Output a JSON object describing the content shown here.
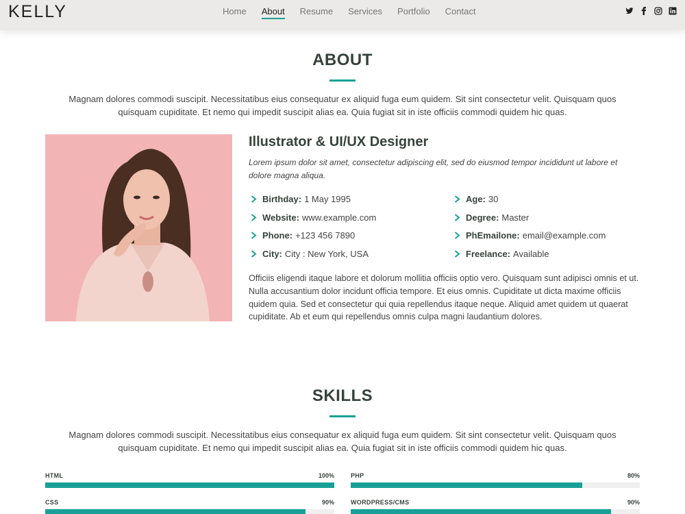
{
  "header": {
    "logo": "KELLY",
    "nav": [
      "Home",
      "About",
      "Resume",
      "Services",
      "Portfolio",
      "Contact"
    ],
    "active_nav": "About",
    "social_icons": [
      "twitter-icon",
      "facebook-icon",
      "instagram-icon",
      "linkedin-icon"
    ]
  },
  "about": {
    "title": "ABOUT",
    "description": "Magnam dolores commodi suscipit. Necessitatibus eius consequatur ex aliquid fuga eum quidem. Sit sint consectetur velit. Quisquam quos quisquam cupiditate. Et nemo qui impedit suscipit alias ea. Quia fugiat sit in iste officiis commodi quidem hic quas.",
    "role": "Illustrator & UI/UX Designer",
    "lead": "Lorem ipsum dolor sit amet, consectetur adipiscing elit, sed do eiusmod tempor incididunt ut labore et dolore magna aliqua.",
    "info_left": [
      {
        "key": "Birthday:",
        "value": "1 May 1995"
      },
      {
        "key": "Website:",
        "value": "www.example.com"
      },
      {
        "key": "Phone:",
        "value": "+123 456 7890"
      },
      {
        "key": "City:",
        "value": "City : New York, USA"
      }
    ],
    "info_right": [
      {
        "key": "Age:",
        "value": "30"
      },
      {
        "key": "Degree:",
        "value": "Master"
      },
      {
        "key": "PhEmailone:",
        "value": "email@example.com"
      },
      {
        "key": "Freelance:",
        "value": "Available"
      }
    ],
    "paragraph": "Officiis eligendi itaque labore et dolorum mollitia officiis optio vero. Quisquam sunt adipisci omnis et ut. Nulla accusantium dolor incidunt officia tempore. Et eius omnis. Cupiditate ut dicta maxime officiis quidem quia. Sed et consectetur qui quia repellendus itaque neque. Aliquid amet quidem ut quaerat cupiditate. Ab et eum qui repellendus omnis culpa magni laudantium dolores."
  },
  "skills": {
    "title": "SKILLS",
    "description": "Magnam dolores commodi suscipit. Necessitatibus eius consequatur ex aliquid fuga eum quidem. Sit sint consectetur velit. Quisquam quos quisquam cupiditate. Et nemo qui impedit suscipit alias ea. Quia fugiat sit in iste officiis commodi quidem hic quas.",
    "items": [
      {
        "name": "HTML",
        "value_label": "100%",
        "level": 100
      },
      {
        "name": "PHP",
        "value_label": "80%",
        "level": 80
      },
      {
        "name": "CSS",
        "value_label": "90%",
        "level": 90
      },
      {
        "name": "WORDPRESS/CMS",
        "value_label": "90%",
        "level": 90
      }
    ]
  },
  "colors": {
    "accent": "#18a096",
    "heading": "#37423b",
    "header_bg": "#eceae8"
  }
}
